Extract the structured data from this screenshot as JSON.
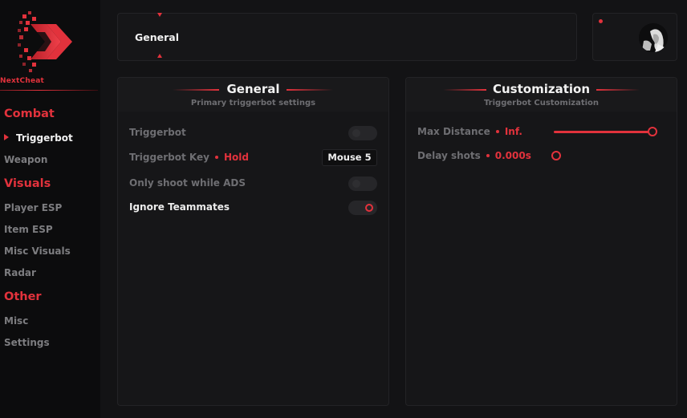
{
  "brand": {
    "name": "NextCheat",
    "accent": "#e2323c"
  },
  "sidebar": {
    "sections": [
      {
        "label": "Combat",
        "items": [
          {
            "label": "Triggerbot",
            "active": true
          },
          {
            "label": "Weapon"
          }
        ]
      },
      {
        "label": "Visuals",
        "items": [
          {
            "label": "Player ESP"
          },
          {
            "label": "Item ESP"
          },
          {
            "label": "Misc Visuals"
          },
          {
            "label": "Radar"
          }
        ]
      },
      {
        "label": "Other",
        "items": [
          {
            "label": "Misc"
          },
          {
            "label": "Settings"
          }
        ]
      }
    ]
  },
  "header": {
    "title": "General"
  },
  "panels": {
    "general": {
      "title": "General",
      "subtitle": "Primary triggerbot settings",
      "triggerbot_label": "Triggerbot",
      "triggerbot_enabled": false,
      "key_label": "Triggerbot Key",
      "key_mode": "Hold",
      "key_value": "Mouse 5",
      "ads_label": "Only shoot while ADS",
      "ads_enabled": false,
      "teammates_label": "Ignore Teammates",
      "teammates_enabled": true
    },
    "customization": {
      "title": "Customization",
      "subtitle": "Triggerbot Customization",
      "max_distance_label": "Max Distance",
      "max_distance_value": "Inf.",
      "max_distance_fraction": 1.0,
      "delay_label": "Delay shots",
      "delay_value": "0.000s",
      "delay_fraction": 0.0
    }
  },
  "icons": {
    "logo": "chevron-double-logo-icon",
    "avatar": "user-avatar",
    "nav_active": "caret-right-icon"
  }
}
